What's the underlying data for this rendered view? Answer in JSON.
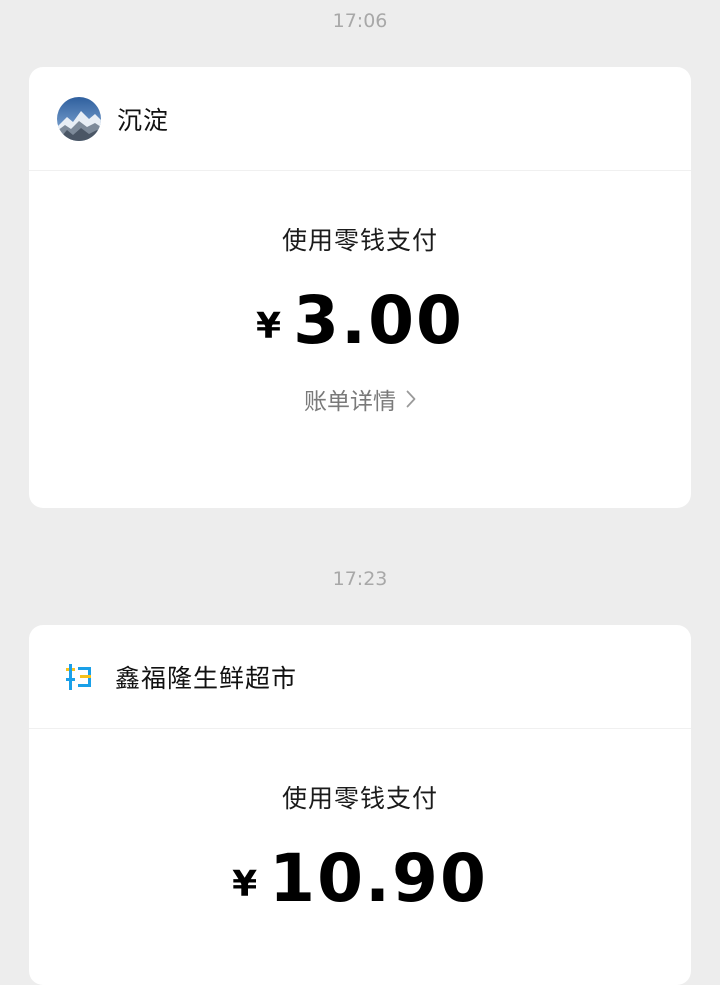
{
  "messages": [
    {
      "time": "17:06",
      "merchant": "沉淀",
      "avatar_type": "photo-avatar",
      "pay_method": "使用零钱支付",
      "currency": "¥",
      "amount": "3.00",
      "detail_link": "账单详情"
    },
    {
      "time": "17:23",
      "merchant": "鑫福隆生鲜超市",
      "avatar_type": "scan-icon",
      "pay_method": "使用零钱支付",
      "currency": "¥",
      "amount": "10.90"
    }
  ],
  "colors": {
    "background": "#ededed",
    "card": "#ffffff",
    "scan_icon_blue": "#1aa0e8",
    "scan_icon_yellow": "#f7c21b"
  }
}
